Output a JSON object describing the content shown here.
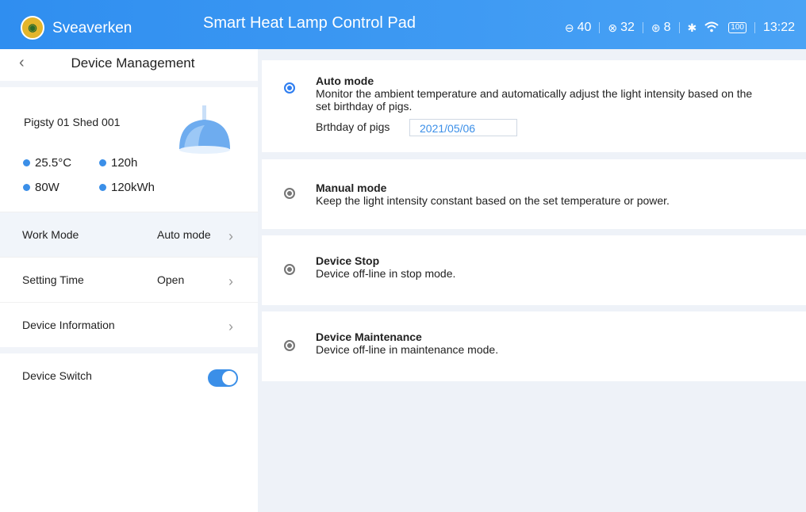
{
  "header": {
    "brand": "Sveaverken",
    "title": "Smart Heat Lamp Control Pad",
    "status": [
      {
        "icon": "temperature-icon",
        "value": "40"
      },
      {
        "icon": "humidity-icon",
        "value": "32"
      },
      {
        "icon": "gas-icon",
        "value": "8"
      }
    ],
    "battery": "100",
    "time": "13:22"
  },
  "sidebar": {
    "title": "Device Management",
    "device_name": "Pigsty 01 Shed 001",
    "metrics": {
      "temperature": "25.5°C",
      "hours": "120h",
      "power": "80W",
      "energy": "120kWh"
    },
    "rows": [
      {
        "label": "Work Mode",
        "value": "Auto mode"
      },
      {
        "label": "Setting Time",
        "value": "Open"
      },
      {
        "label": "Device Information",
        "value": ""
      }
    ],
    "switch_label": "Device Switch"
  },
  "modes": {
    "auto": {
      "title": "Auto mode",
      "desc": "Monitor the ambient temperature and automatically adjust the light intensity based on the set birthday of pigs.",
      "birthday_label": "Brthday of pigs",
      "birthday_value": "2021/05/06"
    },
    "manual": {
      "title": "Manual mode",
      "desc": "Keep the light intensity constant based on the set temperature or power."
    },
    "stop": {
      "title": "Device Stop",
      "desc": "Device off-line in stop mode."
    },
    "maintenance": {
      "title": "Device Maintenance",
      "desc": "Device off-line in maintenance mode."
    }
  },
  "colors": {
    "accent": "#2f7ef0",
    "header_start": "#2f8ef0",
    "header_end": "#4aa3f5"
  }
}
